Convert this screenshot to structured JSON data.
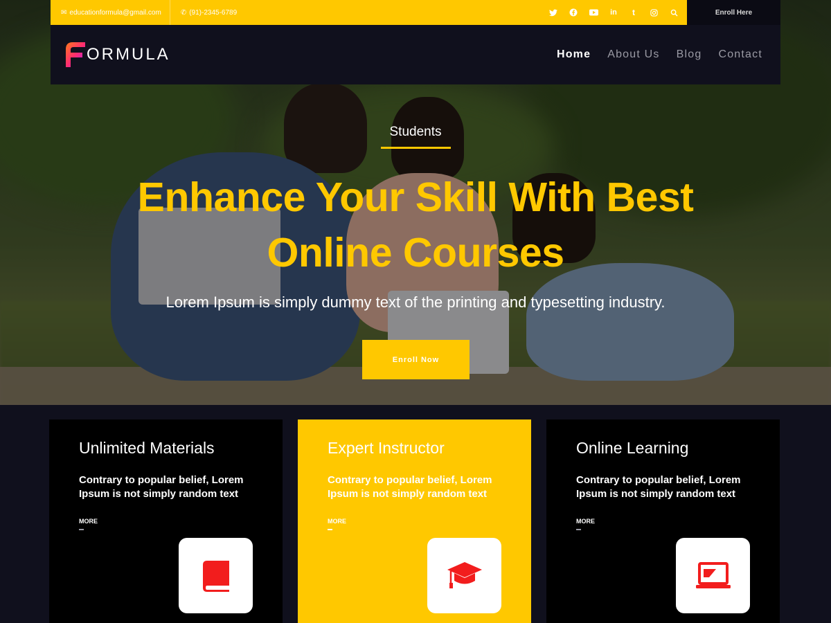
{
  "topbar": {
    "email": "educationformula@gmail.com",
    "phone": "(91)-2345-6789",
    "enroll_label": "Enroll Here",
    "socials": [
      "twitter-icon",
      "facebook-icon",
      "youtube-icon",
      "linkedin-icon",
      "tumblr-icon",
      "instagram-icon",
      "search-icon"
    ]
  },
  "header": {
    "logo_text": "ORMULA",
    "nav": [
      "Home",
      "About Us",
      "Blog",
      "Contact"
    ]
  },
  "hero": {
    "eyebrow": "Students",
    "headline_line1": "Enhance Your Skill With Best",
    "headline_line2": "Online Courses",
    "subline": "Lorem Ipsum is simply dummy text of the printing and typesetting industry.",
    "cta_label": "Enroll Now"
  },
  "features": [
    {
      "title": "Unlimited Materials",
      "text": "Contrary to popular belief, Lorem Ipsum is not simply random text",
      "more": "MORE",
      "icon": "book-icon"
    },
    {
      "title": "Expert Instructor",
      "text": "Contrary to popular belief, Lorem Ipsum is not simply random text",
      "more": "MORE",
      "icon": "graduation-cap-icon"
    },
    {
      "title": "Online Learning",
      "text": "Contrary to popular belief, Lorem Ipsum is not simply random text",
      "more": "MORE",
      "icon": "laptop-icon"
    }
  ],
  "colors": {
    "accent": "#ffc800",
    "dark": "#10101d",
    "icon_red": "#f21d1d"
  }
}
